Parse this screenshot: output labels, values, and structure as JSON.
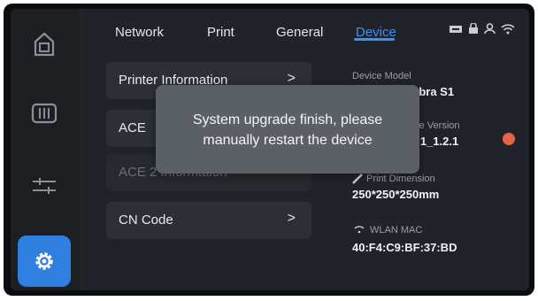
{
  "tabs": [
    {
      "label": "Network"
    },
    {
      "label": "Print"
    },
    {
      "label": "General"
    },
    {
      "label": "Device",
      "active": true
    }
  ],
  "sidebar": {
    "items": [
      {
        "icon": "home-icon"
      },
      {
        "icon": "filament-spool-icon"
      },
      {
        "icon": "calibration-icon"
      },
      {
        "icon": "gear-icon",
        "active": true
      }
    ]
  },
  "status_icons": [
    "printer-status-icon",
    "lock-icon",
    "user-icon",
    "wifi-icon"
  ],
  "menu": {
    "items": [
      {
        "label": "Printer Information",
        "chevron": ">"
      },
      {
        "label": "ACE",
        "chevron": ">"
      },
      {
        "label": "ACE 2 Information",
        "chevron": ">",
        "disabled": true
      },
      {
        "label": "CN Code",
        "chevron": ">"
      }
    ]
  },
  "device_info": {
    "model_label": "Device Model",
    "model_value": "Kobra S1",
    "version_label": "re Version",
    "version_value": "2.1_1.2.1",
    "dimension_label": "Print Dimension",
    "dimension_value": "250*250*250mm",
    "mac_label": "WLAN MAC",
    "mac_value": "40:F4:C9:BF:37:BD"
  },
  "dialog": {
    "line1": "System upgrade finish, please",
    "line2": "manually restart the device"
  },
  "colors": {
    "accent": "#3d8ff0",
    "background": "#202329",
    "card": "#2c2f35",
    "dialog": "#5b5f66",
    "update_dot": "#e8614c"
  }
}
